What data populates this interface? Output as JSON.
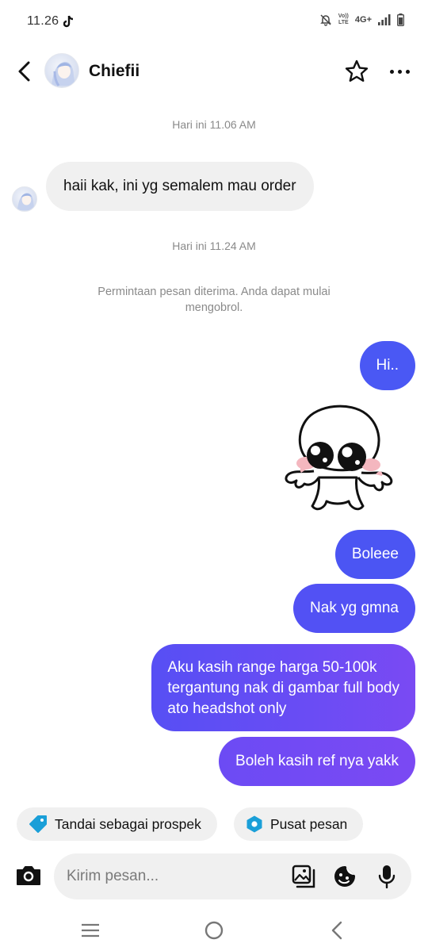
{
  "status_bar": {
    "time": "11.26",
    "network_label": "4G+",
    "volte_top": "Vo))",
    "volte_bottom": "LTE",
    "icons": [
      "tiktok-icon",
      "mute-icon",
      "signal-icon",
      "battery-icon"
    ]
  },
  "header": {
    "contact_name": "Chiefii",
    "icons": [
      "back-arrow-icon",
      "star-icon",
      "more-icon"
    ]
  },
  "chat": {
    "timestamp_1": "Hari ini 11.06 AM",
    "incoming_message": "haii kak, ini yg semalem mau order",
    "timestamp_2": "Hari ini 11.24 AM",
    "system_note": "Permintaan pesan diterima. Anda dapat mulai mengobrol.",
    "outgoing": [
      "Hi..",
      "Boleee",
      "Nak yg gmna",
      "Aku kasih range harga 50-100k",
      "tergantung nak di gambar full body",
      "ato headshot only",
      "Boleh kasih ref nya yakk"
    ]
  },
  "chips": {
    "label_1": "Tandai sebagai prospek",
    "label_2": "Pusat pesan"
  },
  "composer": {
    "placeholder": "Kirim pesan..."
  },
  "colors": {
    "bubble_blue": "#4a58f4",
    "bubble_purple": "#7a4af3",
    "incoming_bg": "#f0f0f0",
    "tag_icon": "#1a9fd8"
  }
}
